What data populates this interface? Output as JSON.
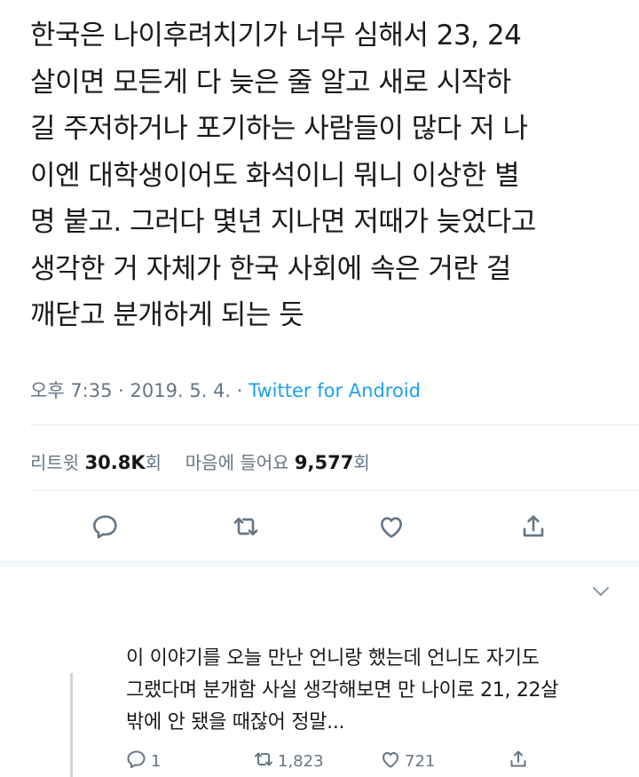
{
  "tweet": {
    "text_lines": [
      "한국은 나이후려치기가 너무 심해서 23, 24",
      "살이면 모든게 다 늦은 줄 알고 새로 시작하",
      "길 주저하거나 포기하는 사람들이 많다 저 나",
      "이엔 대학생이어도 화석이니 뭐니 이상한 별",
      "명 붙고. 그러다 몇년 지나면 저때가 늦었다고",
      "생각한 거 자체가 한국 사회에 속은 거란 걸",
      "깨닫고 분개하게 되는 듯"
    ],
    "time": "오후 7:35",
    "date": "2019. 5. 4.",
    "separator": "·",
    "source": "Twitter for Android",
    "retweets_label": "리트윗",
    "retweets_count": "30.8K",
    "retweets_suffix": "회",
    "likes_label": "마음에 들어요",
    "likes_count": "9,577",
    "likes_suffix": "회"
  },
  "actions": {
    "reply_icon": "reply-icon",
    "retweet_icon": "retweet-icon",
    "like_icon": "heart-icon",
    "share_icon": "share-icon"
  },
  "reply": {
    "text_lines": [
      "이 이야기를 오늘 만난 언니랑 했는데 언니도 자기도",
      "그랬다며 분개함 사실 생각해보면 만 나이로 21, 22살",
      "밖에 안 됐을 때잖어 정말..."
    ],
    "reply_count": "1",
    "retweet_count": "1,823",
    "like_count": "721"
  },
  "colors": {
    "accent": "#1da1f2",
    "muted": "#657786",
    "text": "#14171a"
  }
}
